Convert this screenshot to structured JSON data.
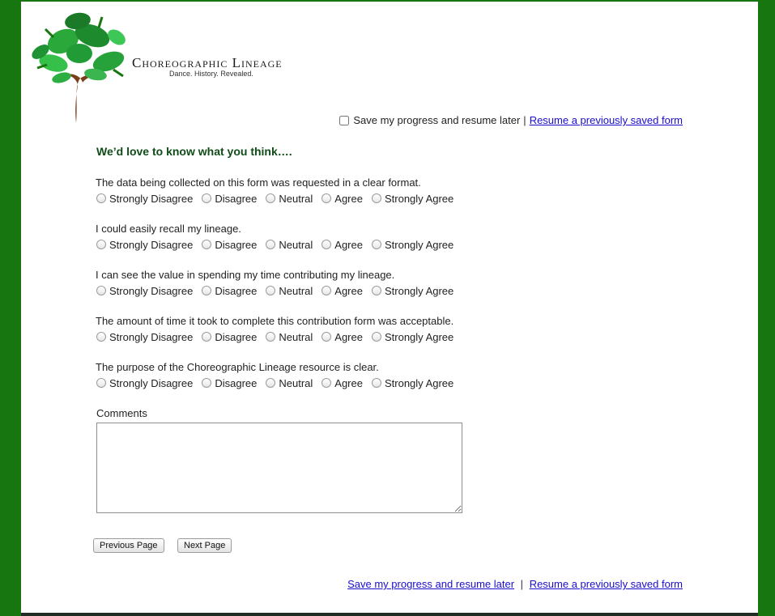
{
  "brand": {
    "title": "Choreographic Lineage",
    "tagline": "Dance. History. Revealed."
  },
  "top_bar": {
    "save_checkbox_label": "Save my progress and resume later",
    "separator": "|",
    "resume_link": "Resume a previously saved form"
  },
  "form": {
    "heading": "We’d love to know what you think….",
    "scale": [
      "Strongly Disagree",
      "Disagree",
      "Neutral",
      "Agree",
      "Strongly Agree"
    ],
    "questions": [
      " The data being collected on this form was requested in a clear format.",
      "I could easily recall my lineage.",
      "I can see the value in spending my time contributing my lineage.",
      "The amount of time it took to complete this contribution form was acceptable.",
      "The purpose of the Choreographic Lineage resource is clear."
    ],
    "comments_label": "Comments",
    "comments_value": ""
  },
  "buttons": {
    "previous": "Previous Page",
    "next": "Next Page"
  },
  "bottom_bar": {
    "save_link": "Save my progress and resume later",
    "separator": "|",
    "resume_link": "Resume a previously saved form"
  },
  "colors": {
    "background_green": "#17760f",
    "heading_green": "#0f4c17",
    "link_blue": "#1a0dcc"
  }
}
